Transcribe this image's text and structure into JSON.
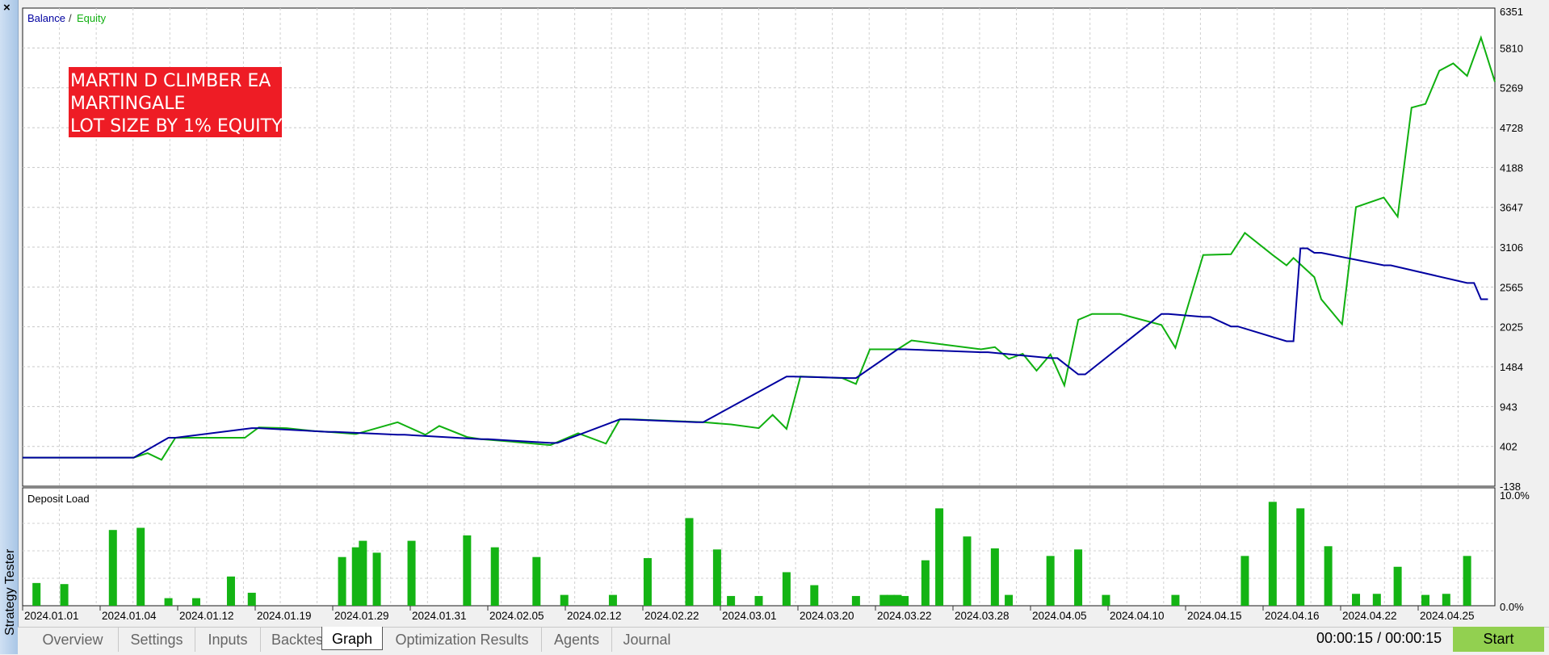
{
  "window": {
    "close_glyph": "×",
    "title": "Strategy Tester"
  },
  "legend": {
    "balance": "Balance",
    "separator": " / ",
    "equity": "Equity"
  },
  "colors": {
    "balance": "#0000a0",
    "equity": "#10b010",
    "bars": "#14b414",
    "banner_bg": "#ee1c25",
    "start_button": "#92d050"
  },
  "banner": {
    "lines": [
      "MARTIN D CLIMBER EA",
      "MARTINGALE",
      "LOT SIZE BY 1% EQUITY"
    ]
  },
  "main_chart": {
    "type": "line",
    "y_ticks": [
      "6351",
      "5810",
      "5269",
      "4728",
      "4188",
      "3647",
      "3106",
      "2565",
      "2025",
      "1484",
      "943",
      "402",
      "-138"
    ],
    "ylim": [
      -138,
      6351
    ],
    "x_labels": [
      "2024.01.01",
      "2024.01.04",
      "2024.01.12",
      "2024.01.19",
      "2024.01.29",
      "2024.01.31",
      "2024.02.05",
      "2024.02.12",
      "2024.02.22",
      "2024.03.01",
      "2024.03.20",
      "2024.03.22",
      "2024.03.28",
      "2024.04.05",
      "2024.04.10",
      "2024.04.15",
      "2024.04.16",
      "2024.04.22",
      "2024.04.25"
    ],
    "grid": true
  },
  "chart_data": [
    {
      "type": "line",
      "title": "",
      "ylim": [
        -138,
        6351
      ],
      "series": [
        {
          "name": "Balance",
          "x": [
            0,
            8,
            10.5,
            11,
            16.5,
            17,
            22,
            22.5,
            27,
            27.5,
            33,
            33.5,
            38,
            38.5,
            43,
            43.5,
            48.5,
            49,
            55,
            55.5,
            59.5,
            60,
            63,
            63.5,
            69,
            69.5,
            74,
            74.5,
            76,
            76.5,
            82,
            82.5,
            85,
            85.5,
            87,
            87.5,
            91,
            91.5,
            92,
            92.5,
            93,
            93.5,
            98,
            98.5,
            104,
            104.5,
            105,
            105.5
          ],
          "y": [
            250,
            250,
            520,
            520,
            650,
            650,
            600,
            600,
            560,
            560,
            500,
            500,
            450,
            450,
            770,
            770,
            730,
            730,
            1350,
            1350,
            1330,
            1330,
            1720,
            1720,
            1680,
            1680,
            1600,
            1600,
            1380,
            1380,
            2200,
            2200,
            2160,
            2160,
            2030,
            2030,
            1830,
            1830,
            3090,
            3090,
            3030,
            3030,
            2860,
            2860,
            2620,
            2620,
            2400,
            2400
          ]
        },
        {
          "name": "Equity",
          "x": [
            0,
            8,
            9,
            10,
            11,
            12,
            16,
            17,
            19,
            21,
            22,
            24,
            27,
            29,
            30,
            32,
            33,
            35,
            38,
            40,
            42,
            43,
            44,
            49,
            51,
            53,
            54,
            55,
            56,
            59,
            60,
            61,
            63,
            64,
            69,
            70,
            71,
            72,
            73,
            74,
            75,
            76,
            77,
            78,
            79,
            82,
            83,
            85,
            87,
            88,
            90,
            91,
            91.5,
            93,
            93.5,
            95,
            96,
            98,
            99,
            100,
            101,
            102,
            103,
            104,
            105,
            106
          ],
          "y": [
            250,
            250,
            310,
            220,
            520,
            520,
            520,
            660,
            650,
            610,
            600,
            570,
            730,
            560,
            680,
            530,
            500,
            470,
            420,
            580,
            440,
            770,
            770,
            730,
            700,
            650,
            830,
            640,
            1350,
            1330,
            1250,
            1720,
            1720,
            1840,
            1720,
            1750,
            1590,
            1660,
            1430,
            1650,
            1230,
            2120,
            2200,
            2200,
            2200,
            2050,
            1740,
            3000,
            3010,
            3300,
            3000,
            2860,
            2960,
            2700,
            2400,
            2060,
            3650,
            3780,
            3520,
            5000,
            5050,
            5500,
            5600,
            5430,
            5950,
            5350
          ]
        }
      ]
    },
    {
      "type": "bar",
      "title": "Deposit Load",
      "yticks": [
        "10.0%",
        "0.0%"
      ],
      "ylim": [
        0,
        10
      ],
      "x_positions": [
        1,
        3,
        6.5,
        8.5,
        10.5,
        12.5,
        15,
        16.5,
        23,
        24,
        24.5,
        25.5,
        28,
        32,
        34,
        37,
        39,
        42.5,
        45,
        48,
        50,
        51,
        53,
        55,
        57,
        60,
        62,
        62.5,
        63,
        63.5,
        65,
        66,
        68,
        70,
        71,
        74,
        76,
        78,
        83,
        88,
        90,
        92,
        94,
        96,
        97.5,
        99,
        101,
        102.5,
        104
      ],
      "values": [
        2.1,
        2.0,
        7.0,
        7.2,
        0.7,
        0.7,
        2.7,
        1.2,
        4.5,
        5.4,
        6.0,
        4.9,
        6.0,
        6.5,
        5.4,
        4.5,
        1.0,
        1.0,
        4.4,
        8.1,
        5.2,
        0.9,
        0.9,
        3.1,
        1.9,
        0.9,
        1.0,
        1.0,
        1.0,
        0.9,
        4.2,
        9.0,
        6.4,
        5.3,
        1.0,
        4.6,
        5.2,
        1.0,
        1.0,
        4.6,
        9.6,
        9.0,
        5.5,
        1.1,
        1.1,
        3.6,
        1.0,
        1.1,
        4.6
      ]
    }
  ],
  "deposit_chart": {
    "title": "Deposit Load",
    "ytick_top": "10.0%",
    "ytick_bottom": "0.0%"
  },
  "tabs": [
    "Overview",
    "Settings",
    "Inputs",
    "Backtest",
    "Graph",
    "Optimization Results",
    "Agents",
    "Journal"
  ],
  "active_tab": "Graph",
  "timer": "00:00:15 / 00:00:15",
  "start_button": "Start"
}
